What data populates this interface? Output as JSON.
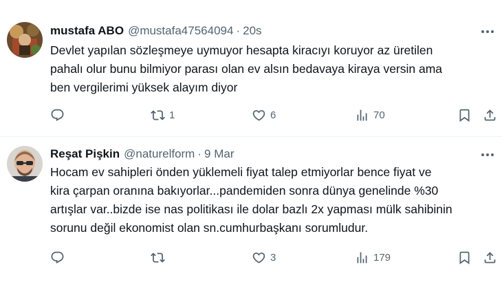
{
  "tweets": [
    {
      "author": {
        "name": "mustafa ABO",
        "handle": "@mustafa47564094",
        "separator": "·",
        "time": "20s"
      },
      "text_lines": [
        "Devlet yapılan sözleşmeye uymuyor hesapta kiracıyı koruyor az üretilen",
        "pahalı olur bunu bilmiyor parası olan ev alsın bedavaya kiraya versin ama",
        "ben vergilerimi yüksek alayım diyor"
      ],
      "stats": {
        "replies": "",
        "retweets": "1",
        "likes": "6",
        "views": "70"
      }
    },
    {
      "author": {
        "name": "Reşat Pişkin",
        "handle": "@naturelform",
        "separator": "·",
        "time": "9 Mar"
      },
      "text_lines": [
        "Hocam ev sahipleri önden yüklemeli fiyat talep etmiyorlar bence fiyat ve",
        "kira çarpan oranına bakıyorlar...pandemiden sonra dünya genelinde %30",
        "artışlar var..bizde ise nas politikası ile dolar bazlı 2x yapması mülk sahibinin",
        "sorunu değil ekonomist olan sn.cumhurbaşkanı sorumludur."
      ],
      "stats": {
        "replies": "",
        "retweets": "",
        "likes": "3",
        "views": "179"
      }
    }
  ],
  "icons": {
    "reply": "reply-icon",
    "retweet": "retweet-icon",
    "like": "heart-icon",
    "views": "views-icon",
    "bookmark": "bookmark-icon",
    "share": "share-icon",
    "more": "more-icon"
  },
  "colors": {
    "text": "#0f1419",
    "secondary": "#536471",
    "divider": "#eff3f4"
  }
}
